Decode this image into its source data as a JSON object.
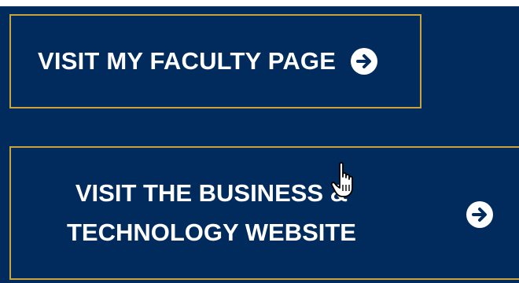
{
  "links": {
    "faculty_page": {
      "label": "VISIT MY FACULTY PAGE",
      "icon": "arrow-right-circle-icon"
    },
    "business_website": {
      "line1": "VISIT THE BUSINESS &",
      "line2": "TECHNOLOGY WEBSITE",
      "icon": "arrow-right-circle-icon"
    }
  },
  "colors": {
    "background": "#002b5c",
    "border": "#c9a43a",
    "text": "#ffffff"
  },
  "cursor": {
    "icon": "hand-pointer-icon"
  }
}
